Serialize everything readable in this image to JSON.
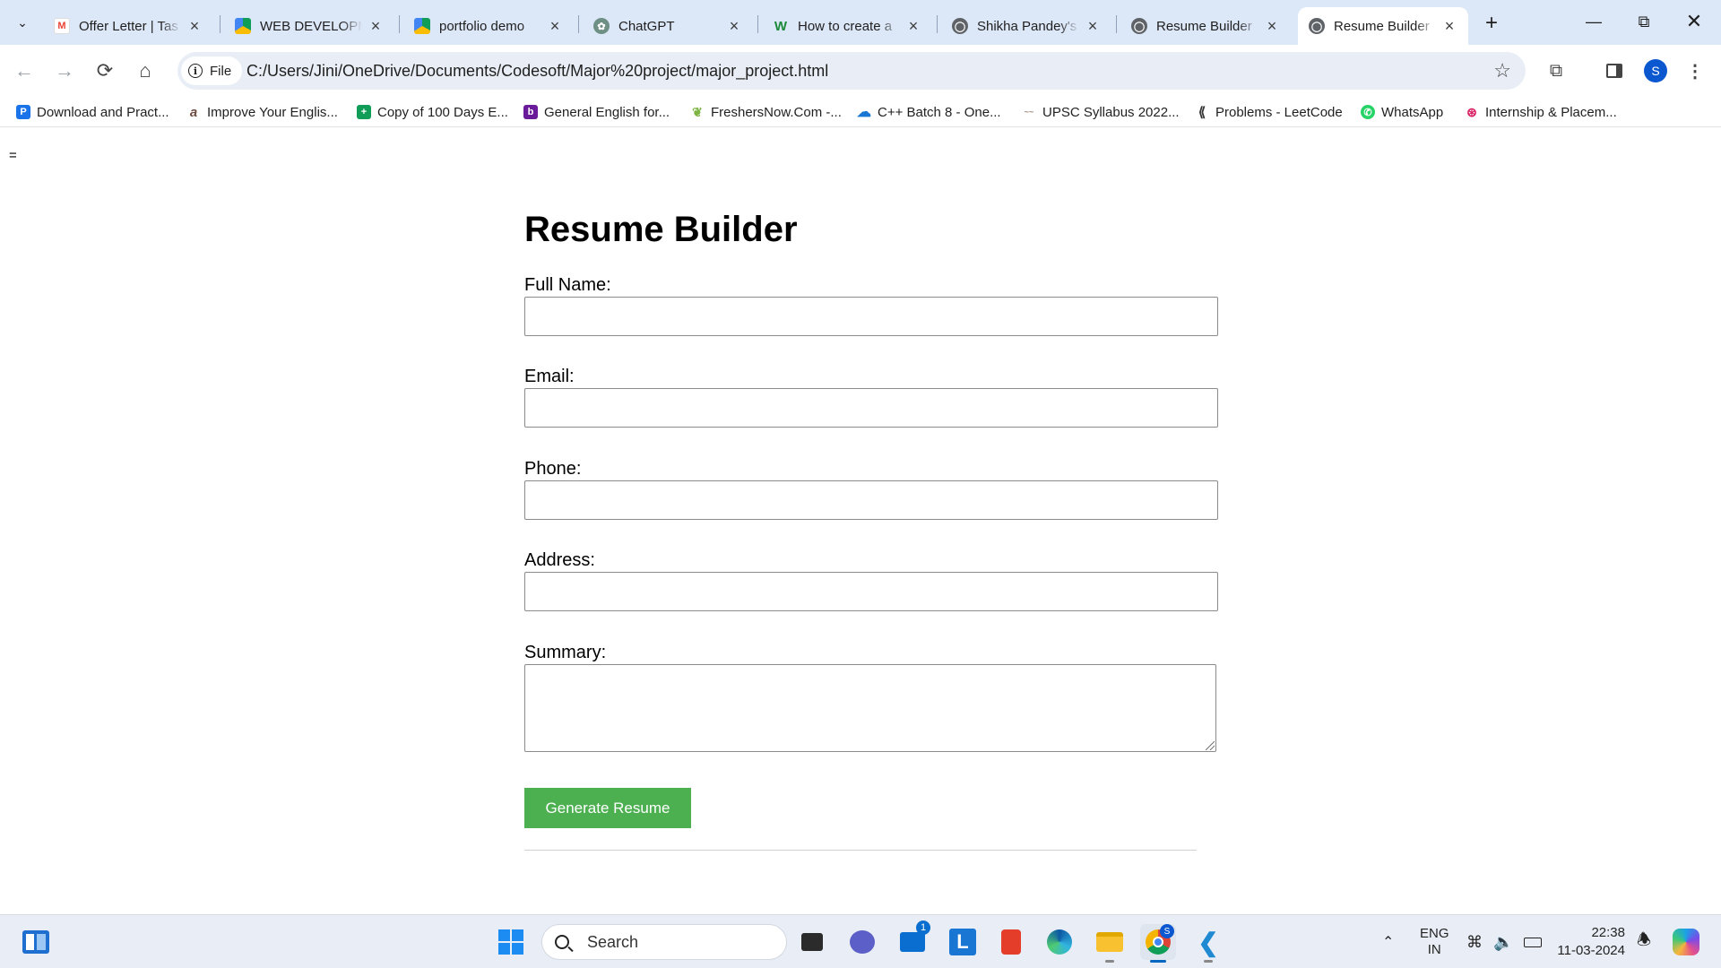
{
  "browser": {
    "tabs": [
      {
        "title": "Offer Letter | Tas",
        "favicon": "gmail-icon",
        "active": false
      },
      {
        "title": "WEB DEVELOPM",
        "favicon": "google-drive-icon",
        "active": false
      },
      {
        "title": "portfolio demo",
        "favicon": "google-drive-icon",
        "active": false
      },
      {
        "title": "ChatGPT",
        "favicon": "chatgpt-icon",
        "active": false
      },
      {
        "title": "How to create a",
        "favicon": "w-icon",
        "active": false
      },
      {
        "title": "Shikha Pandey's",
        "favicon": "globe-icon",
        "active": false
      },
      {
        "title": "Resume Builder",
        "favicon": "globe-icon",
        "active": false
      },
      {
        "title": "Resume Builder",
        "favicon": "globe-icon",
        "active": true
      }
    ],
    "address": {
      "chip_label": "File",
      "url": "C:/Users/Jini/OneDrive/Documents/Codesoft/Major%20project/major_project.html"
    },
    "profile_initial": "S",
    "bookmarks": [
      {
        "label": "Download and Pract...",
        "icon": "p-icon",
        "color": "#1a73e8"
      },
      {
        "label": "Improve Your Englis...",
        "icon": "a-icon",
        "color": "#6d4c41"
      },
      {
        "label": "Copy of 100 Days E...",
        "icon": "sheets-icon",
        "color": "#0f9d58"
      },
      {
        "label": "General English for...",
        "icon": "b-icon",
        "color": "#6a1b9a"
      },
      {
        "label": "FreshersNow.Com -...",
        "icon": "leaf-icon",
        "color": "#7cb342"
      },
      {
        "label": "C++ Batch 8 - One...",
        "icon": "cloud-icon",
        "color": "#1976d2"
      },
      {
        "label": "UPSC Syllabus 2022...",
        "icon": "logo-icon",
        "color": "#a1887f"
      },
      {
        "label": "Problems - LeetCode",
        "icon": "leetcode-icon",
        "color": "#f89f1b"
      },
      {
        "label": "WhatsApp",
        "icon": "whatsapp-icon",
        "color": "#25d366"
      },
      {
        "label": "Internship & Placem...",
        "icon": "network-icon",
        "color": "#d81b60"
      }
    ]
  },
  "page": {
    "top_left_text": "=",
    "heading": "Resume Builder",
    "fields": {
      "full_name": {
        "label": "Full Name:",
        "value": ""
      },
      "email": {
        "label": "Email:",
        "value": ""
      },
      "phone": {
        "label": "Phone:",
        "value": ""
      },
      "address": {
        "label": "Address:",
        "value": ""
      },
      "summary": {
        "label": "Summary:",
        "value": ""
      }
    },
    "generate_button": "Generate Resume",
    "button_color": "#4caf50"
  },
  "taskbar": {
    "search_placeholder": "Search",
    "mail_badge": "1",
    "chrome_badge": "S",
    "language": "ENG",
    "region": "IN",
    "time": "22:38",
    "date": "11-03-2024"
  }
}
